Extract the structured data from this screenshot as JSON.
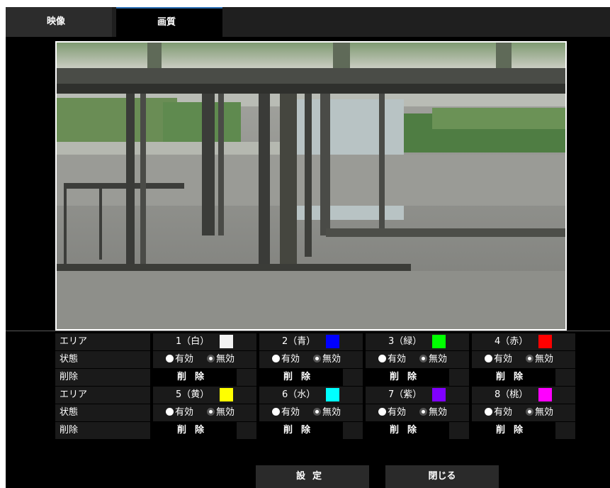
{
  "tabs": [
    {
      "label": "映像",
      "active": false
    },
    {
      "label": "画質",
      "active": true
    }
  ],
  "rows": {
    "area_label": "エリア",
    "status_label": "状態",
    "delete_label": "削除"
  },
  "areas": [
    {
      "name": "1（白）",
      "color": "#f2f2f2",
      "enabled": false
    },
    {
      "name": "2（青）",
      "color": "#0000ff",
      "enabled": false
    },
    {
      "name": "3（緑）",
      "color": "#00ff00",
      "enabled": false
    },
    {
      "name": "4（赤）",
      "color": "#ff0000",
      "enabled": false
    },
    {
      "name": "5（黄）",
      "color": "#ffff00",
      "enabled": false
    },
    {
      "name": "6（水）",
      "color": "#00ffff",
      "enabled": false
    },
    {
      "name": "7（紫）",
      "color": "#8000ff",
      "enabled": false
    },
    {
      "name": "8（桃）",
      "color": "#ff00ff",
      "enabled": false
    }
  ],
  "options": {
    "enable": "有効",
    "disable": "無効"
  },
  "delete_button": "削除",
  "buttons": {
    "set": "設定",
    "close": "閉じる"
  }
}
